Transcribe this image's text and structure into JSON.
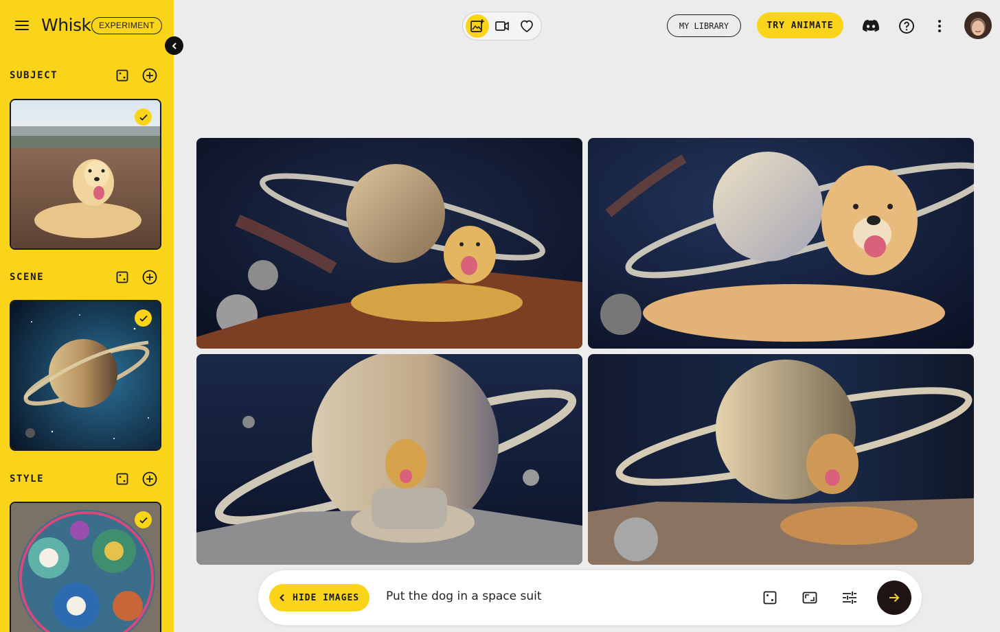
{
  "app": {
    "title": "Whisk",
    "badge": "EXPERIMENT"
  },
  "sidebar": {
    "sections": [
      {
        "label": "SUBJECT",
        "image_desc": "golden-retriever-photo"
      },
      {
        "label": "SCENE",
        "image_desc": "saturn-space-photo"
      },
      {
        "label": "STYLE",
        "image_desc": "mosaic-tile-photo"
      }
    ]
  },
  "topbar": {
    "modes": [
      "image-mode-icon",
      "video-mode-icon",
      "heart-icon"
    ],
    "library_label": "MY LIBRARY",
    "animate_label": "TRY ANIMATE"
  },
  "results": {
    "count": 4
  },
  "prompt": {
    "hide_label": "HIDE IMAGES",
    "text": "Put the dog in a space suit"
  },
  "colors": {
    "accent": "#f9d41a",
    "background": "#ececec",
    "dark": "#1f1413"
  }
}
